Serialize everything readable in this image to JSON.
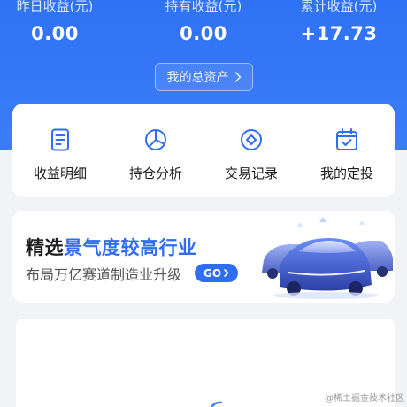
{
  "stats": [
    {
      "label": "昨日收益(元)",
      "value": "0.00"
    },
    {
      "label": "持有收益(元)",
      "value": "0.00"
    },
    {
      "label": "累计收益(元)",
      "value": "+17.73"
    }
  ],
  "assets_button": {
    "label": "我的总资产"
  },
  "menu": [
    {
      "label": "收益明细",
      "icon": "document-icon"
    },
    {
      "label": "持仓分析",
      "icon": "pie-chart-icon"
    },
    {
      "label": "交易记录",
      "icon": "diamond-circle-icon"
    },
    {
      "label": "我的定投",
      "icon": "calendar-check-icon"
    }
  ],
  "banner": {
    "title_plain": "精选",
    "title_highlight": "景气度较高行业",
    "subtitle": "布局万亿赛道制造业升级",
    "go_label": "GO"
  },
  "watermark": "@稀土掘金技术社区",
  "colors": {
    "brand_blue": "#2f72f5",
    "highlight_blue": "#2f6df4",
    "background": "#f1f3f7"
  }
}
